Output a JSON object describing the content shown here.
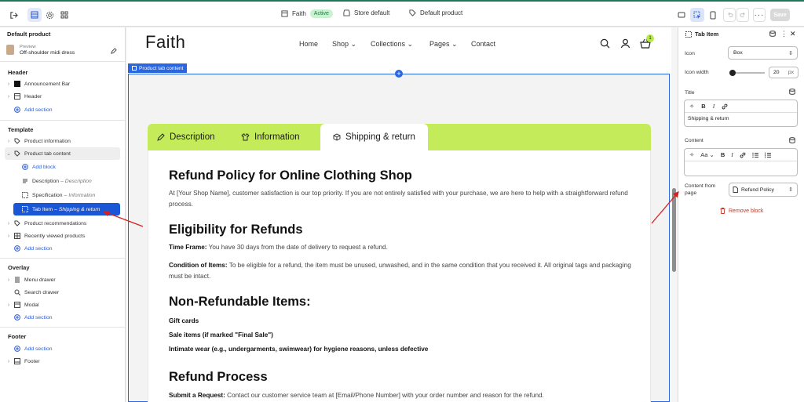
{
  "topbar": {
    "theme_name": "Faith",
    "theme_status": "Active",
    "store_label": "Store default",
    "template_label": "Default product",
    "save_label": "Save"
  },
  "left": {
    "title": "Default product",
    "preview_label": "Preview",
    "preview_product": "Off-shoulder midi dress",
    "header_heading": "Header",
    "header_items": [
      "Announcement Bar",
      "Header"
    ],
    "add_section": "Add section",
    "template_heading": "Template",
    "product_information": "Product information",
    "product_tab_content": "Product tab content",
    "add_block": "Add block",
    "blocks": [
      {
        "name": "Description",
        "sub": "Description"
      },
      {
        "name": "Specification",
        "sub": "Information"
      },
      {
        "name": "Tab Item",
        "sub": "Shipping & return"
      }
    ],
    "template_items_after": [
      "Product recommendations",
      "Recently viewed products"
    ],
    "overlay_heading": "Overlay",
    "overlay_items": [
      "Menu drawer",
      "Search drawer",
      "Modal"
    ],
    "footer_heading": "Footer",
    "footer_items": [
      "Footer"
    ]
  },
  "store": {
    "brand": "Faith",
    "nav": [
      "Home",
      "Shop",
      "Collections",
      "Pages",
      "Contact"
    ],
    "cart_count": "1",
    "section_tag": "Product tab content",
    "tabs": [
      "Description",
      "Information",
      "Shipping & return"
    ],
    "h_refund_policy": "Refund Policy for Online Clothing Shop",
    "intro": "At [Your Shop Name], customer satisfaction is our top priority. If you are not entirely satisfied with your purchase, we are here to help with a straightforward refund process.",
    "h_eligibility": "Eligibility for Refunds",
    "timeframe_label": "Time Frame:",
    "timeframe_text": " You have 30 days from the date of delivery to request a refund.",
    "condition_label": "Condition of Items:",
    "condition_text": " To be eligible for a refund, the item must be unused, unwashed, and in the same condition that you received it. All original tags and packaging must be intact.",
    "h_nonrefundable": "Non-Refundable Items:",
    "nonrefundable_items": [
      "Gift cards",
      "Sale items (if marked \"Final Sale\")",
      "Intimate wear (e.g., undergarments, swimwear) for hygiene reasons, unless defective"
    ],
    "h_process": "Refund Process",
    "submit_label": "Submit a Request:",
    "submit_text": " Contact our customer service team at [Email/Phone Number] with your order number and reason for the refund."
  },
  "right": {
    "title": "Tab Item",
    "icon_label": "Icon",
    "icon_value": "Box",
    "icon_width_label": "Icon width",
    "icon_width_value": "20",
    "icon_width_unit": "px",
    "icon_width_fraction": 0.05,
    "title_label": "Title",
    "title_value": "Shipping & return",
    "content_label": "Content",
    "content_from_page_label": "Content from page",
    "content_from_page_value": "Refund Policy",
    "remove_block": "Remove block"
  },
  "colors": {
    "accent_blue": "#1a57d6",
    "tab_green": "#c4ec5a",
    "active_badge": "#c9f2d0",
    "remove_red": "#c0392b"
  }
}
